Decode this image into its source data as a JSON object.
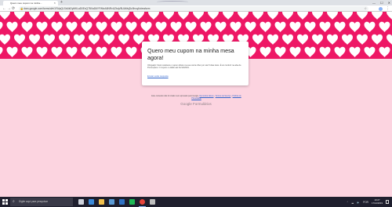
{
  "browser": {
    "tab_title": "Quero meu cupom na minha...",
    "tab_close": "×",
    "new_tab": "+",
    "window_controls": [
      "—",
      "☐",
      "✕"
    ],
    "url": "docs.google.com/forms/d/e/1FAIpQLSdUkDyMKLaD0ExQ7BXaD6YFWkrA5NRvUZbqV8UAMvjDz0hvqA/viewform",
    "nav": {
      "back": "←",
      "forward": "→",
      "reload": "⟳"
    }
  },
  "form": {
    "title": "Quero meu cupom na minha mesa agora!",
    "description": "Obrigado! Você receberá o cupom direto na sua conta Uber por até 5 dias úteis. É só conferir na aba de Promoções. O cupom é válido até 31/12/2019.",
    "edit_link": "Enviar outra resposta",
    "footer_text_prefix": "Este conteúdo não foi criado nem aprovado pelo Google.",
    "footer_links": [
      "Denunciar abuso",
      "Termos de Serviço",
      "Política de Privacidade"
    ],
    "brand_google": "Google",
    "brand_forms": "Formulários"
  },
  "taskbar": {
    "search_placeholder": "Digite aqui para pesquisar",
    "language": "POR",
    "clock_time": "10:27",
    "clock_date": "17/12/2019",
    "apps": [
      {
        "icon": "task-view-icon",
        "color": "#cfd3dc"
      },
      {
        "icon": "edge-icon",
        "color": "#3b8ad9"
      },
      {
        "icon": "file-explorer-icon",
        "color": "#f2c14e"
      },
      {
        "icon": "store-icon",
        "color": "#5b9bd5"
      },
      {
        "icon": "mail-icon",
        "color": "#2f72c4"
      },
      {
        "icon": "spotify-icon",
        "color": "#1db954"
      },
      {
        "icon": "chrome-icon",
        "color": "#e8453c"
      },
      {
        "icon": "settings-icon",
        "color": "#bfbfbf"
      }
    ]
  },
  "colors": {
    "banner": "#ee1765",
    "heart": "#ffffff",
    "page_bg": "#fcd4e0",
    "link": "#3366cc"
  }
}
